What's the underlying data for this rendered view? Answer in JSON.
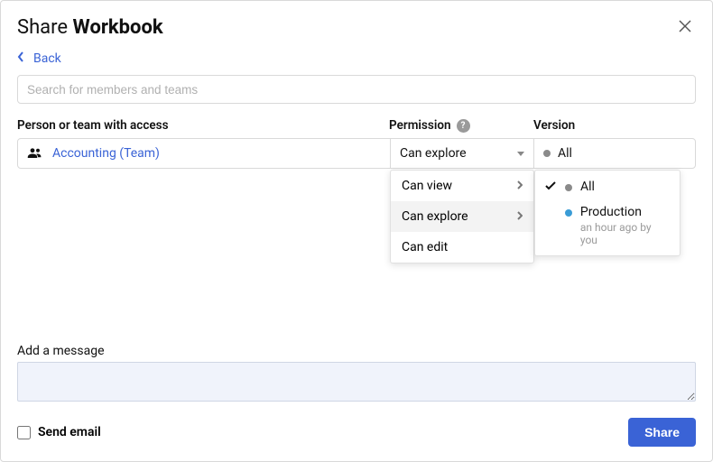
{
  "title_prefix": "Share ",
  "title_bold": "Workbook",
  "back_label": "Back",
  "search_placeholder": "Search for members and teams",
  "columns": {
    "person": "Person or team with access",
    "permission": "Permission",
    "version": "Version"
  },
  "help_glyph": "?",
  "row": {
    "team_name": "Accounting (Team)",
    "permission_selected": "Can explore",
    "version_selected": "All"
  },
  "permission_options": [
    {
      "label": "Can view",
      "has_sub": true
    },
    {
      "label": "Can explore",
      "has_sub": true
    },
    {
      "label": "Can edit",
      "has_sub": false
    }
  ],
  "version_options": [
    {
      "label": "All",
      "dot": "grey",
      "checked": true,
      "meta": ""
    },
    {
      "label": "Production",
      "dot": "blue",
      "checked": false,
      "meta": "an hour ago by you"
    }
  ],
  "message_label": "Add a message",
  "send_email_label": "Send email",
  "share_button": "Share"
}
